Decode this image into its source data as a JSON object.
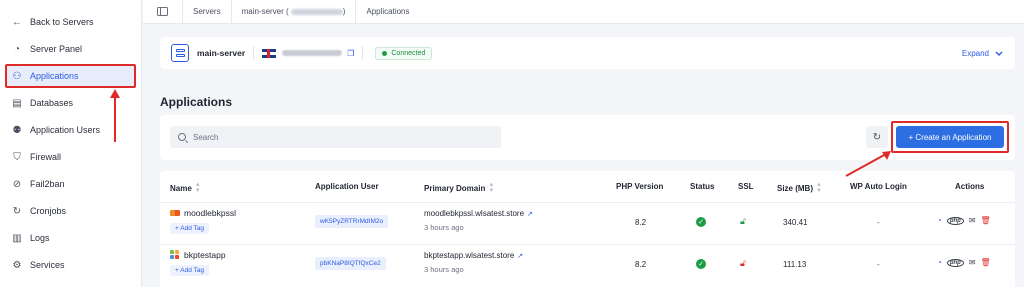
{
  "sidebar": {
    "items": [
      {
        "label": "Back to Servers",
        "icon": "arrow-left-icon",
        "glyph": "←"
      },
      {
        "label": "Server Panel",
        "icon": "gauge-icon",
        "glyph": "◔"
      },
      {
        "label": "Applications",
        "icon": "apps-icon",
        "glyph": "⚇",
        "active": true
      },
      {
        "label": "Databases",
        "icon": "database-icon",
        "glyph": "▤"
      },
      {
        "label": "Application Users",
        "icon": "users-icon",
        "glyph": "⚉"
      },
      {
        "label": "Firewall",
        "icon": "shield-icon",
        "glyph": "⛉"
      },
      {
        "label": "Fail2ban",
        "icon": "ban-icon",
        "glyph": "⊘"
      },
      {
        "label": "Cronjobs",
        "icon": "refresh-icon",
        "glyph": "↻"
      },
      {
        "label": "Logs",
        "icon": "log-file-icon",
        "glyph": "▥"
      },
      {
        "label": "Services",
        "icon": "services-icon",
        "glyph": "⚙"
      }
    ]
  },
  "breadcrumb": {
    "servers": "Servers",
    "server": "main-server (",
    "server_close": ")",
    "current": "Applications"
  },
  "server_card": {
    "name": "main-server",
    "status": "Connected",
    "expand": "Expand",
    "colors": {
      "status": "#1e9c45",
      "accent": "#2d5be3"
    }
  },
  "page": {
    "title": "Applications",
    "search_placeholder": "Search",
    "create_button": "+ Create an Application"
  },
  "table": {
    "headers": {
      "name": "Name",
      "user": "Application User",
      "domain": "Primary Domain",
      "php": "PHP Version",
      "status": "Status",
      "ssl": "SSL",
      "size": "Size (MB)",
      "wp": "WP Auto Login",
      "actions": "Actions"
    },
    "rows": [
      {
        "name": "moodlebkpssl",
        "logo": "moodle-logo-icon",
        "add_tag": "+ Add Tag",
        "user": "wK5PyZRTRrMdIM2o",
        "domain": "moodlebkpssl.wlsatest.store",
        "ago": "3 hours ago",
        "php": "8.2",
        "size": "340.41",
        "wp": "-",
        "ssl_color": "#1e9c45"
      },
      {
        "name": "bkptestapp",
        "logo": "joomla-logo-icon",
        "add_tag": "+ Add Tag",
        "user": "pbKNaP8IQTfQxCe2",
        "domain": "bkptestapp.wlsatest.store",
        "ago": "3 hours ago",
        "php": "8.2",
        "size": "111.13",
        "wp": "-",
        "ssl_color": "#e02a2a"
      }
    ]
  },
  "annotation_color": "#e02a2a"
}
